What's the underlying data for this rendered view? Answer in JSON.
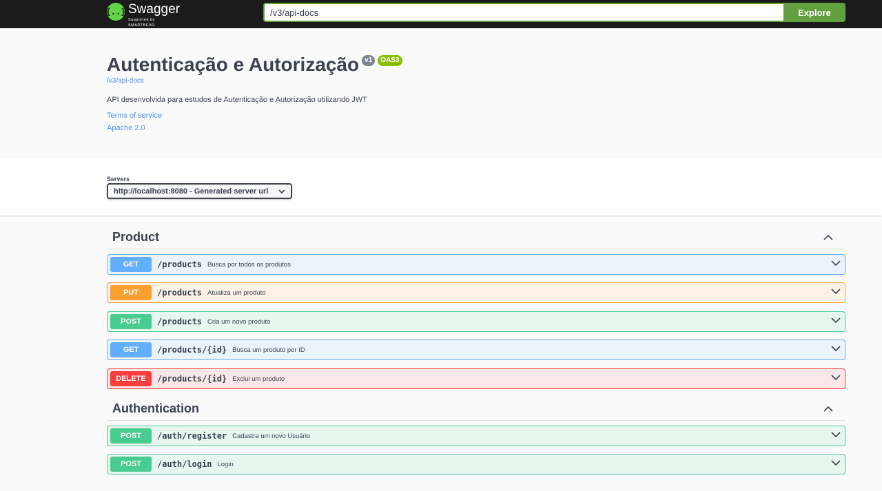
{
  "topbar": {
    "logo_title": "Swagger",
    "logo_subtitle": "Supported by SMARTBEAR",
    "logo_icon": "swagger-logo-icon",
    "url_value": "/v3/api-docs",
    "explore_label": "Explore"
  },
  "info": {
    "title": "Autenticação e Autorização",
    "version_badge": "v1",
    "oas_badge": "OAS3",
    "spec_link": "/v3/api-docs",
    "description": "API desenvolvida para estudos de Autenticação e Autorização utilizando JWT",
    "terms": "Terms of service",
    "license": "Apache 2.0"
  },
  "servers": {
    "label": "Servers",
    "selected": "http://localhost:8080 - Generated server url"
  },
  "tags": [
    {
      "name": "Product",
      "operations": [
        {
          "method": "GET",
          "path": "/products",
          "summary": "Busca por todos os produtos"
        },
        {
          "method": "PUT",
          "path": "/products",
          "summary": "Atualiza um produto"
        },
        {
          "method": "POST",
          "path": "/products",
          "summary": "Cria um novo produto"
        },
        {
          "method": "GET",
          "path": "/products/{id}",
          "summary": "Busca um produto por ID"
        },
        {
          "method": "DELETE",
          "path": "/products/{id}",
          "summary": "Exclui um produto"
        }
      ]
    },
    {
      "name": "Authentication",
      "operations": [
        {
          "method": "POST",
          "path": "/auth/register",
          "summary": "Cadastra um novo Usuário"
        },
        {
          "method": "POST",
          "path": "/auth/login",
          "summary": "Login"
        }
      ]
    }
  ],
  "colors": {
    "get": "#61affe",
    "put": "#fca130",
    "post": "#49cc90",
    "delete": "#f93e3e",
    "accent": "#62a03f"
  }
}
